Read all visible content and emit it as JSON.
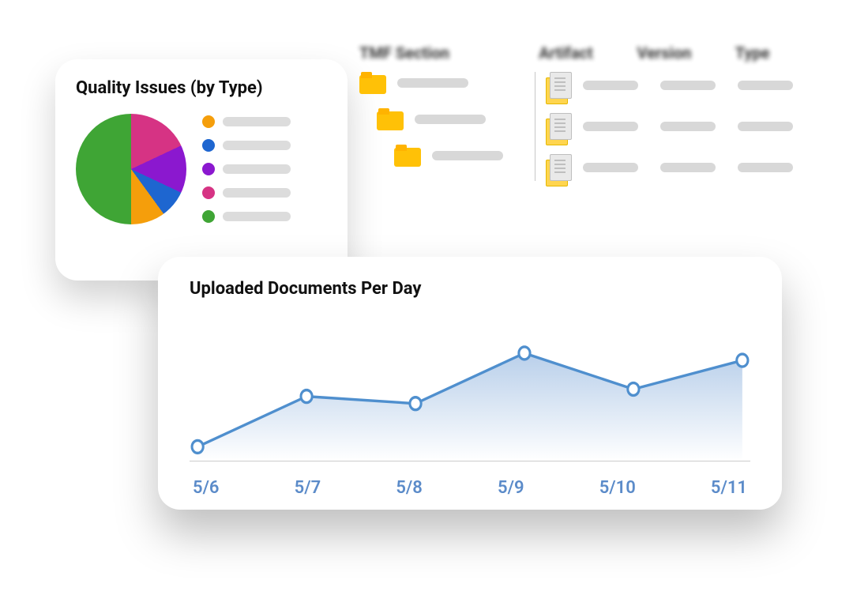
{
  "pie": {
    "title": "Quality Issues (by Type)",
    "legend_colors": [
      "#f59e0b",
      "#1e66d0",
      "#8b18cf",
      "#d63384",
      "#3fa535"
    ]
  },
  "table": {
    "headers": [
      "TMF Section",
      "Artifact",
      "Version",
      "Type"
    ]
  },
  "line": {
    "title": "Uploaded Documents Per Day"
  },
  "chart_data": [
    {
      "type": "pie",
      "title": "Quality Issues (by Type)",
      "series": [
        {
          "name": "Green",
          "value": 50,
          "color": "#3fa535"
        },
        {
          "name": "Pink",
          "value": 18,
          "color": "#d63384"
        },
        {
          "name": "Purple",
          "value": 14,
          "color": "#8b18cf"
        },
        {
          "name": "Blue",
          "value": 8,
          "color": "#1e66d0"
        },
        {
          "name": "Orange",
          "value": 10,
          "color": "#f59e0b"
        }
      ]
    },
    {
      "type": "line",
      "title": "Uploaded Documents Per Day",
      "categories": [
        "5/6",
        "5/7",
        "5/8",
        "5/9",
        "5/10",
        "5/11"
      ],
      "values": [
        10,
        45,
        40,
        75,
        50,
        70
      ],
      "ylim": [
        0,
        100
      ],
      "xlabel": "",
      "ylabel": ""
    }
  ]
}
